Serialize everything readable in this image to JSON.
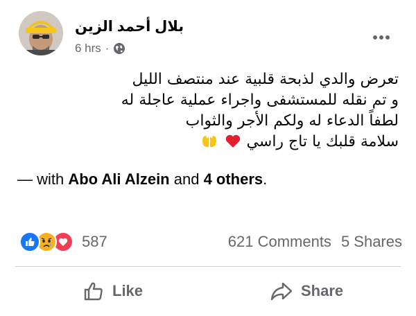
{
  "post": {
    "author": "بلال أحمد الزين",
    "time": "6 hrs",
    "separator": "·",
    "text_lines": [
      "تعرض والدي لذبحة قلبية عند منتصف الليل",
      "و تم نقله للمستشفى واجراء عملية عاجلة له",
      "لطفاً الدعاء له ولكم الأجر والثواب",
      "سلامة قلبك يا تاج راسي"
    ],
    "tagged": {
      "prefix": "— with ",
      "person": "Abo Ali Alzein",
      "joiner": " and ",
      "others": "4 others",
      "suffix": "."
    }
  },
  "reactions": {
    "icons": [
      "like-reaction-icon",
      "sad-reaction-icon",
      "love-reaction-icon"
    ],
    "count": "587"
  },
  "counts": {
    "comments": "621 Comments",
    "shares": "5 Shares"
  },
  "actions": {
    "like": "Like",
    "share": "Share"
  },
  "colors": {
    "like_blue": "#1877f2",
    "love_red": "#f33e58",
    "sad_yellow": "#f7b125",
    "secondary_text": "#65676b"
  }
}
